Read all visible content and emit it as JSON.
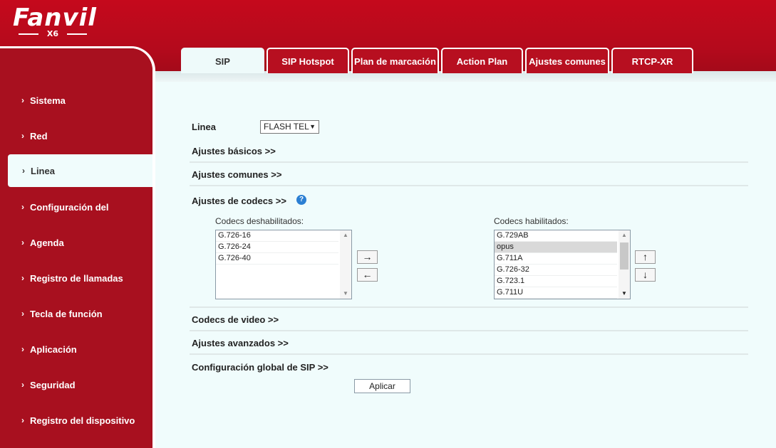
{
  "brand": {
    "logo": "Fanvil",
    "model": "X6"
  },
  "tabs": [
    {
      "label": "SIP",
      "active": true
    },
    {
      "label": "SIP Hotspot"
    },
    {
      "label": "Plan de marcación"
    },
    {
      "label": "Action Plan"
    },
    {
      "label": "Ajustes comunes"
    },
    {
      "label": "RTCP-XR"
    }
  ],
  "sidebar": {
    "items": [
      {
        "label": "Sistema"
      },
      {
        "label": "Red"
      },
      {
        "label": "Linea",
        "active": true
      },
      {
        "label": "Configuración del"
      },
      {
        "label": "Agenda"
      },
      {
        "label": "Registro de llamadas"
      },
      {
        "label": "Tecla de función"
      },
      {
        "label": "Aplicación"
      },
      {
        "label": "Seguridad"
      },
      {
        "label": "Registro del dispositivo"
      }
    ]
  },
  "form": {
    "line_label": "Linea",
    "line_value": "FLASH TEL",
    "basic_settings": "Ajustes básicos >>",
    "common_settings": "Ajustes comunes >>",
    "codec_settings": "Ajustes de codecs >>",
    "help_symbol": "?",
    "disabled_label": "Codecs deshabilitados:",
    "enabled_label": "Codecs habilitados:",
    "disabled_codecs": [
      "G.726-16",
      "G.726-24",
      "G.726-40"
    ],
    "enabled_codecs": [
      "G.729AB",
      "opus",
      "G.711A",
      "G.726-32",
      "G.723.1",
      "G.711U"
    ],
    "enabled_selected": "opus",
    "btn_right": "→",
    "btn_left": "←",
    "btn_up": "↑",
    "btn_down": "↓",
    "video_codecs": "Codecs de video >>",
    "advanced_settings": "Ajustes avanzados >>",
    "global_sip": "Configuración global de SIP >>",
    "apply": "Aplicar"
  },
  "colors": {
    "brand_red": "#b40f21",
    "content_bg": "#f0fcfc",
    "help_blue": "#2b7fd3"
  }
}
